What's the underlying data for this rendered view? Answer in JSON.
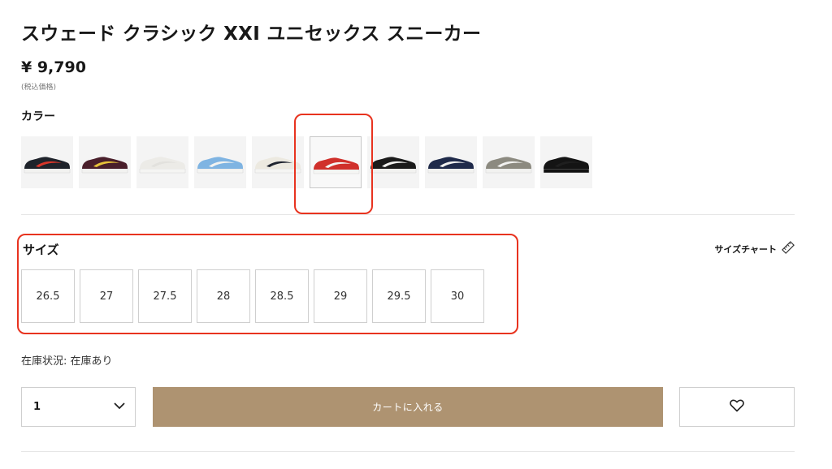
{
  "product": {
    "title": "スウェード クラシック XXI ユニセックス スニーカー",
    "price": "¥ 9,790",
    "tax_note": "(税込価格)"
  },
  "colors": {
    "label": "カラー",
    "swatches": [
      {
        "upper": "#1f232b",
        "stripe": "#d8362a",
        "sole": "#f2f2f0",
        "selected": false
      },
      {
        "upper": "#4a1f2b",
        "stripe": "#e8c33a",
        "sole": "#f2f2f0",
        "selected": false
      },
      {
        "upper": "#ecebe7",
        "stripe": "#e2e1dd",
        "sole": "#f5f5f3",
        "selected": false
      },
      {
        "upper": "#7fb4e2",
        "stripe": "#f2f2f0",
        "sole": "#f5f5f3",
        "selected": false
      },
      {
        "upper": "#ece9e0",
        "stripe": "#1f2430",
        "sole": "#f5f5f3",
        "selected": false
      },
      {
        "upper": "#d0302b",
        "stripe": "#f4f4f2",
        "sole": "#f5f5f3",
        "selected": true
      },
      {
        "upper": "#1b1b1b",
        "stripe": "#f2f2f0",
        "sole": "#f2f2f0",
        "selected": false
      },
      {
        "upper": "#1f2a4a",
        "stripe": "#f2f2f0",
        "sole": "#f2f2f0",
        "selected": false
      },
      {
        "upper": "#8c8a80",
        "stripe": "#f2f2f0",
        "sole": "#f2f2f0",
        "selected": false
      },
      {
        "upper": "#141414",
        "stripe": "#1f1f1f",
        "sole": "#121212",
        "selected": false
      }
    ]
  },
  "sizes": {
    "label": "サイズ",
    "chart_label": "サイズチャート",
    "options": [
      "26.5",
      "27",
      "27.5",
      "28",
      "28.5",
      "29",
      "29.5",
      "30"
    ]
  },
  "stock": {
    "text": "在庫状況: 在庫あり"
  },
  "actions": {
    "quantity": "1",
    "add_to_cart": "カートに入れる"
  },
  "theme": {
    "cart_button_color": "#ae9371",
    "annotation_color": "#e8331f"
  }
}
